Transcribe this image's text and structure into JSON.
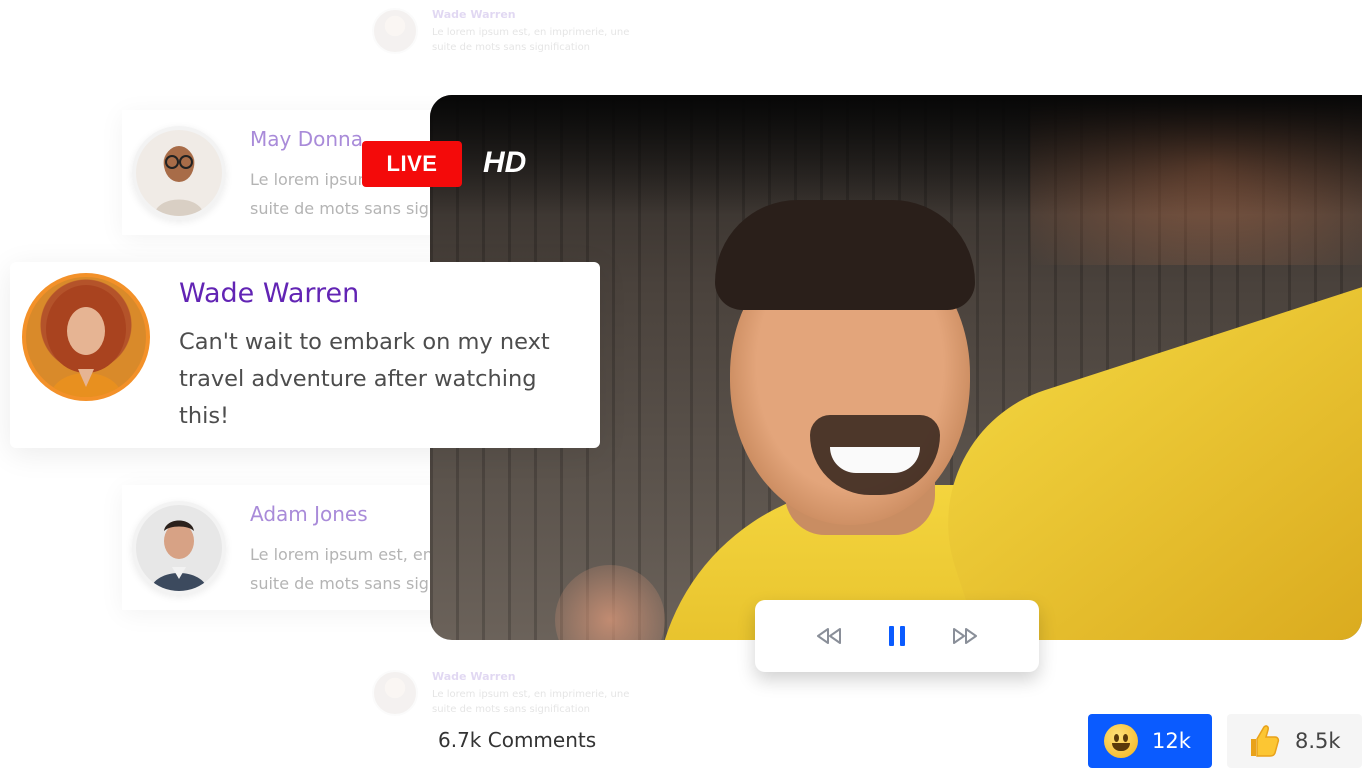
{
  "faded_comments": [
    {
      "name": "Wade Warren",
      "text_line1": "Le lorem ipsum est, en imprimerie, une",
      "text_line2": "suite de mots sans signification"
    },
    {
      "name": "Wade Warren",
      "text_line1": "Le lorem ipsum est, en imprimerie, une",
      "text_line2": "suite de mots sans signification"
    }
  ],
  "comments": [
    {
      "name": "May Donna",
      "text_line1": "Le lorem ipsum est, en imprimerie, une",
      "text_line2": "suite de mots sans signification"
    },
    {
      "name": "Adam Jones",
      "text_line1": "Le lorem ipsum est, en imprimerie, une",
      "text_line2": "suite de mots sans signification"
    }
  ],
  "featured_comment": {
    "name": "Wade Warren",
    "text": "Can't wait to embark on my next travel adventure after watching this!"
  },
  "video": {
    "live_label": "LIVE",
    "quality_label": "HD"
  },
  "controls": {
    "rewind_icon": "rewind-icon",
    "pause_icon": "pause-icon",
    "forward_icon": "fast-forward-icon",
    "accent": "#0a5bff"
  },
  "footer": {
    "comments_count": "6.7k Comments",
    "reactions": [
      {
        "icon": "smiley-emoji-icon",
        "count": "12k",
        "color": "#0a5bff"
      },
      {
        "icon": "thumbs-up-emoji-icon",
        "count": "8.5k",
        "color": "#f5f5f5"
      }
    ]
  }
}
